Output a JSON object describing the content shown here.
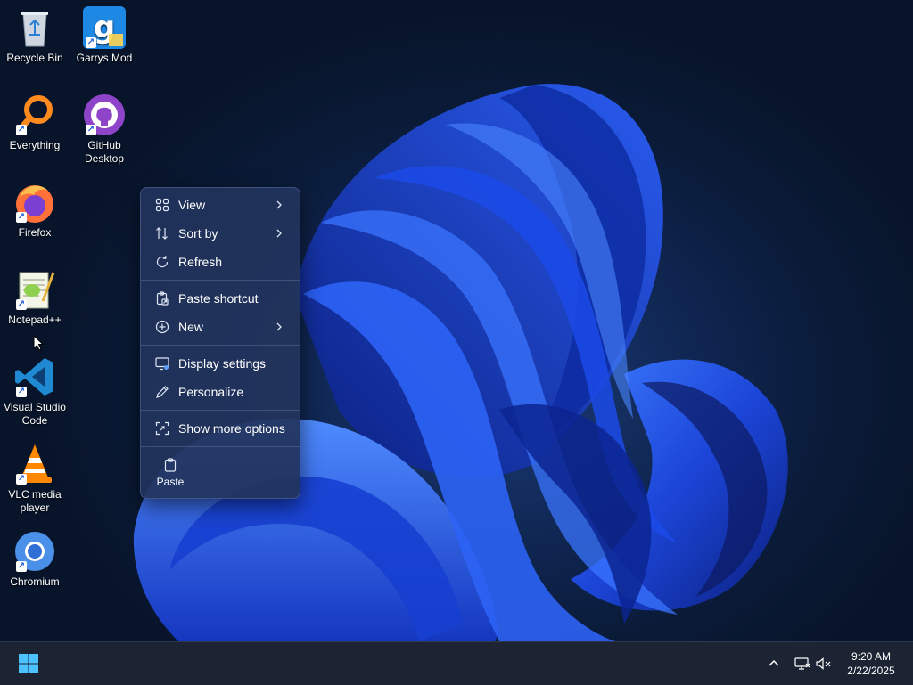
{
  "desktop": {
    "icons": [
      {
        "label": "Recycle Bin",
        "icon": "recycle-bin-icon",
        "shortcut": false
      },
      {
        "label": "Garrys Mod",
        "icon": "garrys-mod-icon",
        "shortcut": true
      },
      {
        "label": "Everything",
        "icon": "everything-search-icon",
        "shortcut": true
      },
      {
        "label": "GitHub Desktop",
        "icon": "github-desktop-icon",
        "shortcut": true
      },
      {
        "label": "Firefox",
        "icon": "firefox-icon",
        "shortcut": true
      },
      {
        "label": "Notepad++",
        "icon": "notepadpp-icon",
        "shortcut": true
      },
      {
        "label": "Visual Studio Code",
        "icon": "vscode-icon",
        "shortcut": true
      },
      {
        "label": "VLC media player",
        "icon": "vlc-icon",
        "shortcut": true
      },
      {
        "label": "Chromium",
        "icon": "chromium-icon",
        "shortcut": true
      }
    ],
    "shortcut_glyph": "↗"
  },
  "context_menu": {
    "items": [
      {
        "label": "View",
        "icon": "view-grid-icon",
        "submenu": true
      },
      {
        "label": "Sort by",
        "icon": "sort-icon",
        "submenu": true
      },
      {
        "label": "Refresh",
        "icon": "refresh-icon",
        "submenu": false
      },
      {
        "label": "Paste shortcut",
        "icon": "paste-shortcut-icon",
        "submenu": false
      },
      {
        "label": "New",
        "icon": "new-plus-icon",
        "submenu": true
      },
      {
        "label": "Display settings",
        "icon": "display-settings-icon",
        "submenu": false
      },
      {
        "label": "Personalize",
        "icon": "pen-icon",
        "submenu": false
      },
      {
        "label": "Show more options",
        "icon": "show-more-icon",
        "submenu": false
      }
    ],
    "quick_actions": [
      {
        "label": "Paste",
        "icon": "clipboard-icon"
      }
    ]
  },
  "taskbar": {
    "start_icon": "windows-start-icon",
    "tray": {
      "chevron_icon": "chevron-up-icon",
      "network_icon": "network-icon",
      "volume_icon": "volume-muted-icon"
    },
    "clock": {
      "time": "9:20 AM",
      "date": "2/22/2025"
    }
  },
  "colors": {
    "accent": "#1f5bd8",
    "taskbar_bg": "#1c2333",
    "menu_bg": "#22345c"
  }
}
